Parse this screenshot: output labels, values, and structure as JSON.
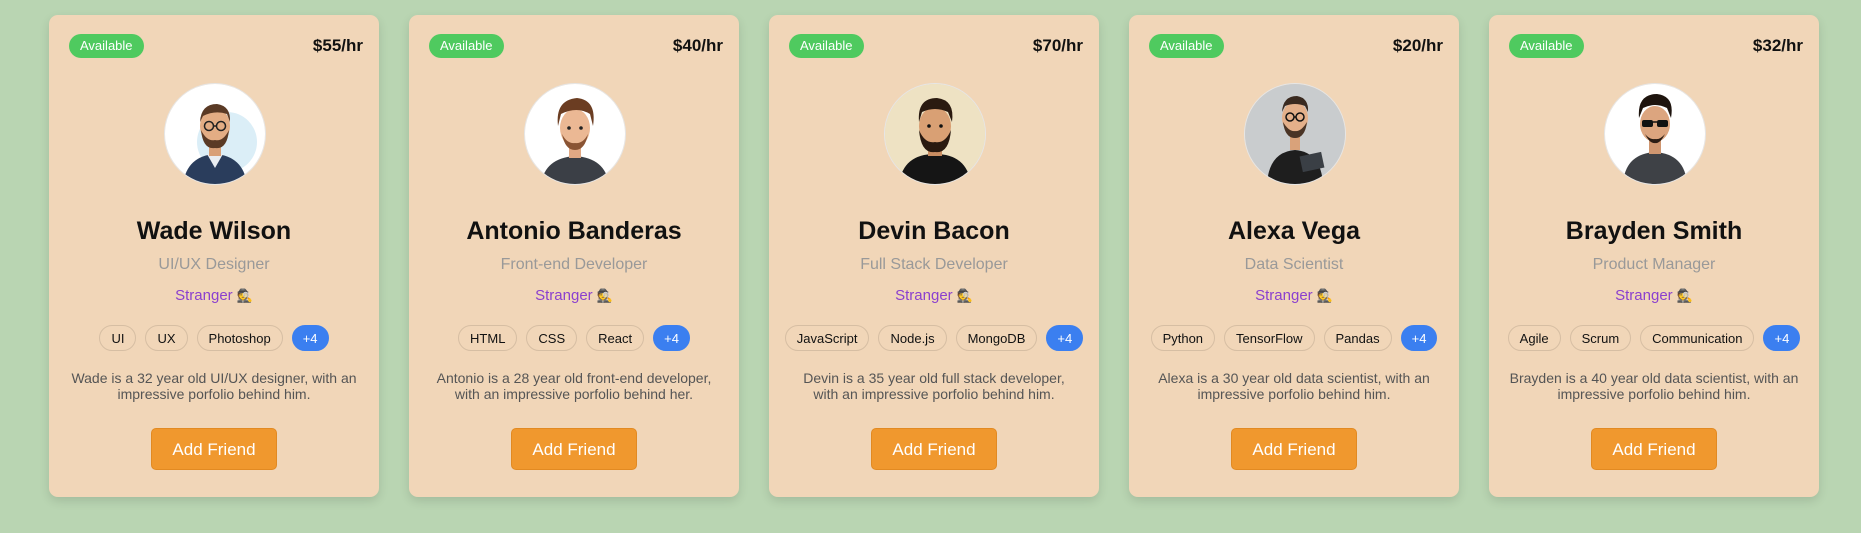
{
  "colors": {
    "page_background": "#b9d5b2",
    "card_background": "#f1d6b8",
    "available_badge": "#4fca5f",
    "relation_text": "#8a3fcf",
    "more_tag": "#3b7ff0",
    "button": "#f0982e"
  },
  "cards": [
    {
      "status": "Available",
      "rate": "$55/hr",
      "avatar_icon": "man-glasses-beard-avatar",
      "name": "Wade Wilson",
      "role": "UI/UX Designer",
      "relation": "Stranger",
      "relation_icon": "🕵",
      "skills": [
        "UI",
        "UX",
        "Photoshop"
      ],
      "more": "+4",
      "description": "Wade is a 32 year old UI/UX designer, with an impressive porfolio behind him.",
      "button": "Add Friend"
    },
    {
      "status": "Available",
      "rate": "$40/hr",
      "avatar_icon": "man-long-hair-avatar",
      "name": "Antonio Banderas",
      "role": "Front-end Developer",
      "relation": "Stranger",
      "relation_icon": "🕵",
      "skills": [
        "HTML",
        "CSS",
        "React"
      ],
      "more": "+4",
      "description": "Antonio is a 28 year old front-end developer, with an impressive porfolio behind her.",
      "button": "Add Friend"
    },
    {
      "status": "Available",
      "rate": "$70/hr",
      "avatar_icon": "man-beard-hoodie-avatar",
      "name": "Devin Bacon",
      "role": "Full Stack Developer",
      "relation": "Stranger",
      "relation_icon": "🕵",
      "skills": [
        "JavaScript",
        "Node.js",
        "MongoDB"
      ],
      "more": "+4",
      "description": "Devin is a 35 year old full stack developer, with an impressive porfolio behind him.",
      "button": "Add Friend"
    },
    {
      "status": "Available",
      "rate": "$20/hr",
      "avatar_icon": "man-glasses-laptop-avatar",
      "name": "Alexa Vega",
      "role": "Data Scientist",
      "relation": "Stranger",
      "relation_icon": "🕵",
      "skills": [
        "Python",
        "TensorFlow",
        "Pandas"
      ],
      "more": "+4",
      "description": "Alexa is a 30 year old data scientist, with an impressive porfolio behind him.",
      "button": "Add Friend"
    },
    {
      "status": "Available",
      "rate": "$32/hr",
      "avatar_icon": "man-sunglasses-avatar",
      "name": "Brayden Smith",
      "role": "Product Manager",
      "relation": "Stranger",
      "relation_icon": "🕵",
      "skills": [
        "Agile",
        "Scrum",
        "Communication"
      ],
      "more": "+4",
      "description": "Brayden is a 40 year old data scientist, with an impressive porfolio behind him.",
      "button": "Add Friend"
    }
  ]
}
